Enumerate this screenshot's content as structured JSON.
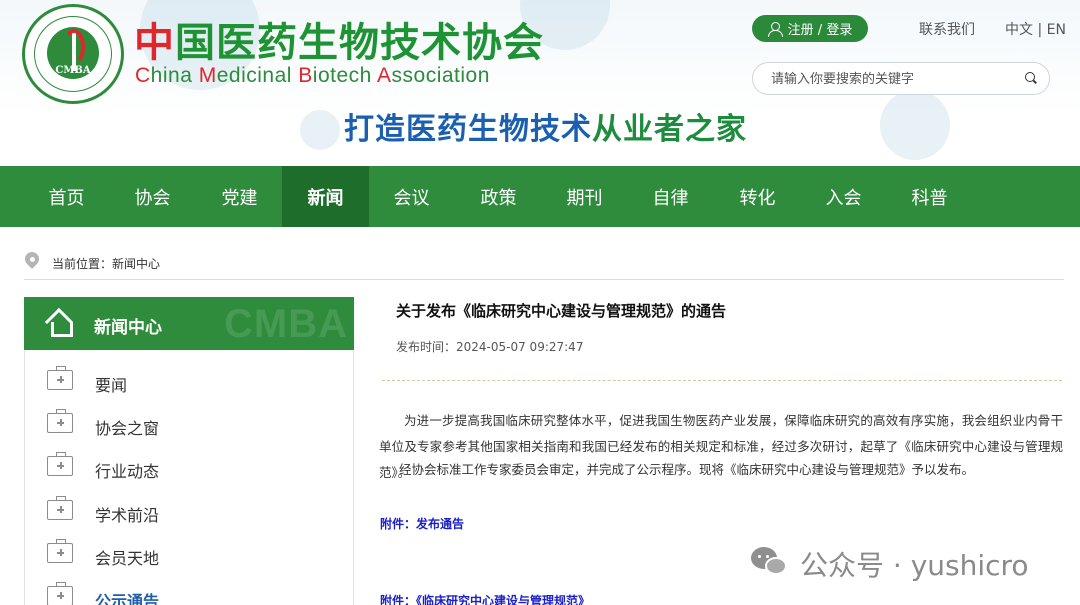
{
  "header": {
    "logo_abbr": "CMBA",
    "logo_name_cn_first": "中",
    "logo_name_cn_rest": "国医药生物技术协会",
    "logo_name_en": [
      {
        "cap": "C",
        "rest": "hina "
      },
      {
        "cap": "M",
        "rest": "edicinal "
      },
      {
        "cap": "B",
        "rest": "iotech "
      },
      {
        "cap": "A",
        "rest": "ssociation"
      }
    ],
    "slogan_part1": "打造医药生物技术",
    "slogan_part2": "从业者之家",
    "login_label": "注册 / 登录",
    "contact_label": "联系我们",
    "lang_label": "中文 | EN",
    "search_placeholder": "请输入你要搜索的关键字"
  },
  "nav": {
    "items": [
      "首页",
      "协会",
      "党建",
      "新闻",
      "会议",
      "政策",
      "期刊",
      "自律",
      "转化",
      "入会",
      "科普"
    ],
    "active_index": 3
  },
  "breadcrumb": {
    "text": "当前位置：新闻中心"
  },
  "sidebar": {
    "title": "新闻中心",
    "watermark": "CMBA",
    "items": [
      "要闻",
      "协会之窗",
      "行业动态",
      "学术前沿",
      "会员天地",
      "公示通告"
    ],
    "active_index": 5
  },
  "article": {
    "title": "关于发布《临床研究中心建设与管理规范》的通告",
    "date": "发布时间：2024-05-07 09:27:47",
    "paragraph1": "为进一步提高我国临床研究整体水平，促进我国生物医药产业发展，保障临床研究的高效有序实施，我会组织业内骨干单位及专家参考其他国家相关指南和我国已经发布的相关规定和标准，经过多次研讨，起草了《临床研究中心建设与管理规范》。",
    "paragraph2": "经协会标准工作专家委员会审定，并完成了公示程序。现将《临床研究中心建设与管理规范》予以发布。",
    "attachment1": "附件：发布通告",
    "attachment2": "附件：《临床研究中心建设与管理规范》"
  },
  "watermark": {
    "text": "公众号 · yushicro"
  },
  "colors": {
    "brand_green": "#2e8c3c",
    "active_nav": "#1f6d2a",
    "logo_red": "#e0262b",
    "link_blue": "#1a1fc9"
  }
}
